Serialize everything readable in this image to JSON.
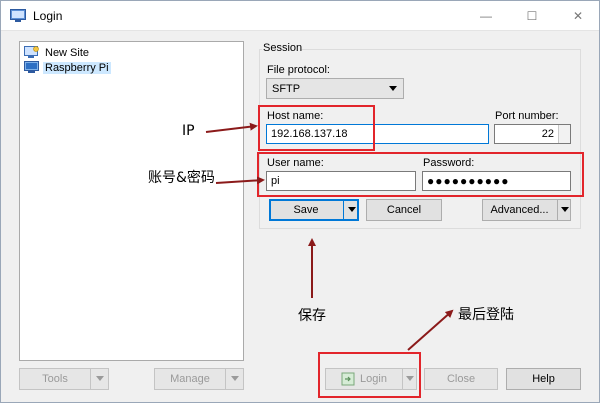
{
  "window": {
    "title": "Login",
    "controls": {
      "minimize": "—",
      "maximize": "☐",
      "close": "✕"
    }
  },
  "site_tree": {
    "items": [
      {
        "label": "New Site",
        "icon": "new-site-icon",
        "selected": false
      },
      {
        "label": "Raspberry Pi",
        "icon": "computer-icon",
        "selected": true
      }
    ]
  },
  "left_buttons": {
    "tools": "Tools",
    "manage": "Manage"
  },
  "session": {
    "group_label": "Session",
    "file_protocol_label": "File protocol:",
    "file_protocol_value": "SFTP",
    "host_name_label": "Host name:",
    "host_name_value": "192.168.137.18",
    "port_number_label": "Port number:",
    "port_number_value": "22",
    "user_name_label": "User name:",
    "user_name_value": "pi",
    "password_label": "Password:",
    "password_value": "●●●●●●●●●●"
  },
  "session_buttons": {
    "save": "Save",
    "cancel": "Cancel",
    "advanced": "Advanced..."
  },
  "bottom_buttons": {
    "login": "Login",
    "close": "Close",
    "help": "Help"
  },
  "annotations": {
    "ip": "IP",
    "credentials": "账号&密码",
    "save": "保存",
    "login": "最后登陆"
  },
  "colors": {
    "highlight": "#e2252b",
    "arrow": "#8b1a1a",
    "focus_border": "#0078d7",
    "selection": "#cde8ff"
  }
}
